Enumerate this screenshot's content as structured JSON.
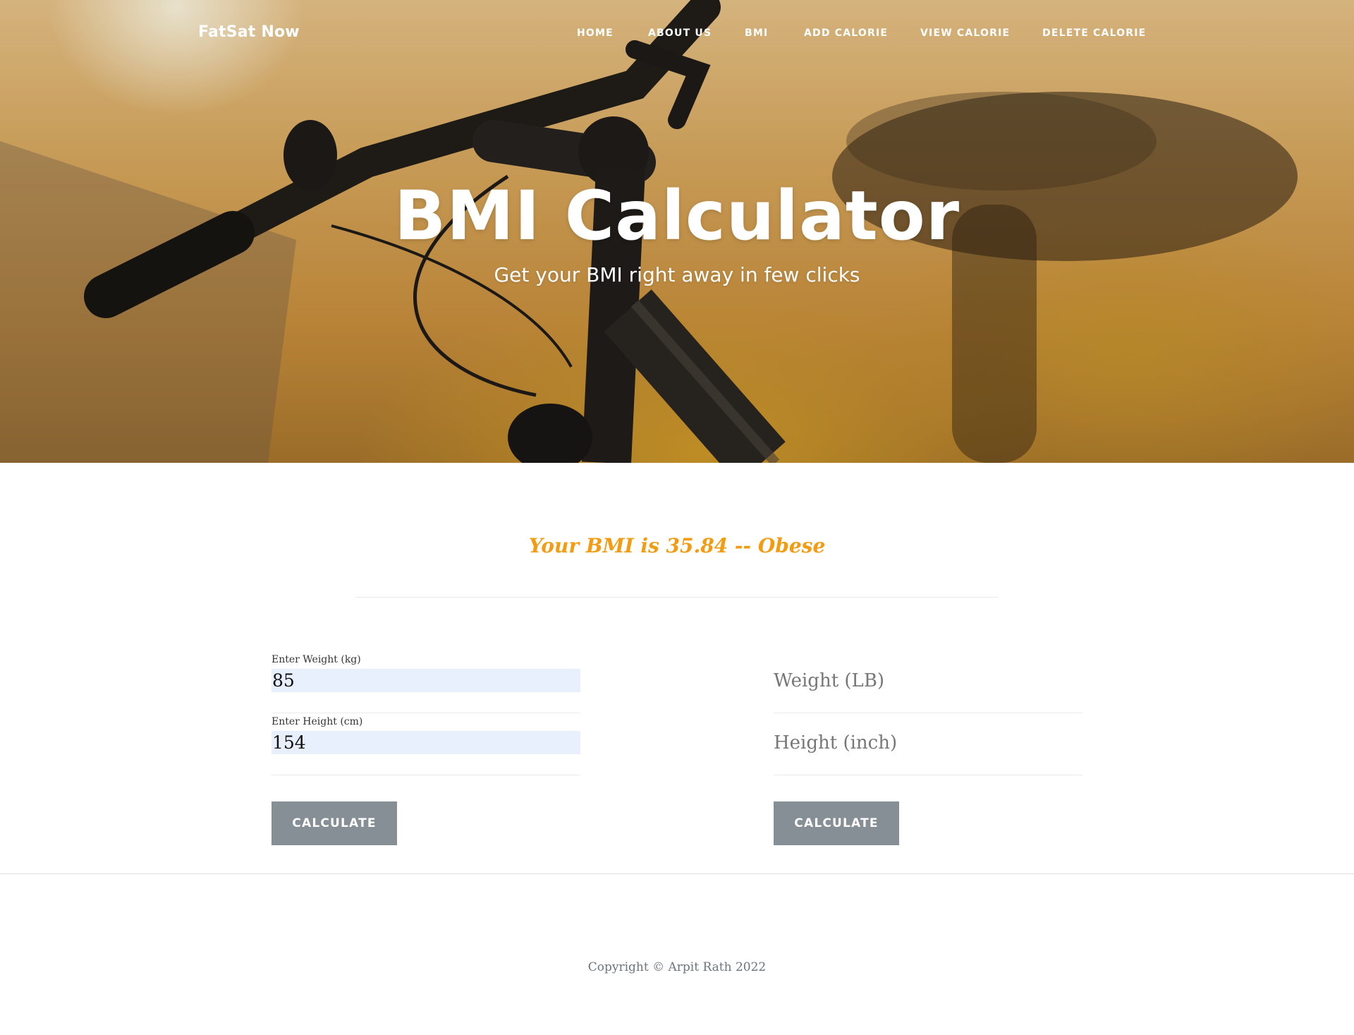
{
  "nav": {
    "brand": "FatSat Now",
    "items": [
      {
        "label": "HOME"
      },
      {
        "label": "ABOUT US"
      },
      {
        "label": "BMI"
      },
      {
        "label": "ADD CALORIE"
      },
      {
        "label": "VIEW CALORIE"
      },
      {
        "label": "DELETE CALORIE"
      }
    ]
  },
  "hero": {
    "title": "BMI Calculator",
    "subtitle": "Get your BMI right away in few clicks"
  },
  "result": {
    "text": "Your BMI is 35.84 -- Obese",
    "color": "#f39c12"
  },
  "metric_form": {
    "weight_label": "Enter Weight (kg)",
    "weight_value": "85",
    "height_label": "Enter Height (cm)",
    "height_value": "154",
    "button_label": "CALCULATE"
  },
  "imperial_form": {
    "weight_placeholder": "Weight (LB)",
    "height_placeholder": "Height (inch)",
    "button_label": "CALCULATE"
  },
  "footer": {
    "copyright": "Copyright © Arpit Rath 2022"
  },
  "colors": {
    "button_bg": "#868e96",
    "input_bg": "#e8f0fe"
  }
}
